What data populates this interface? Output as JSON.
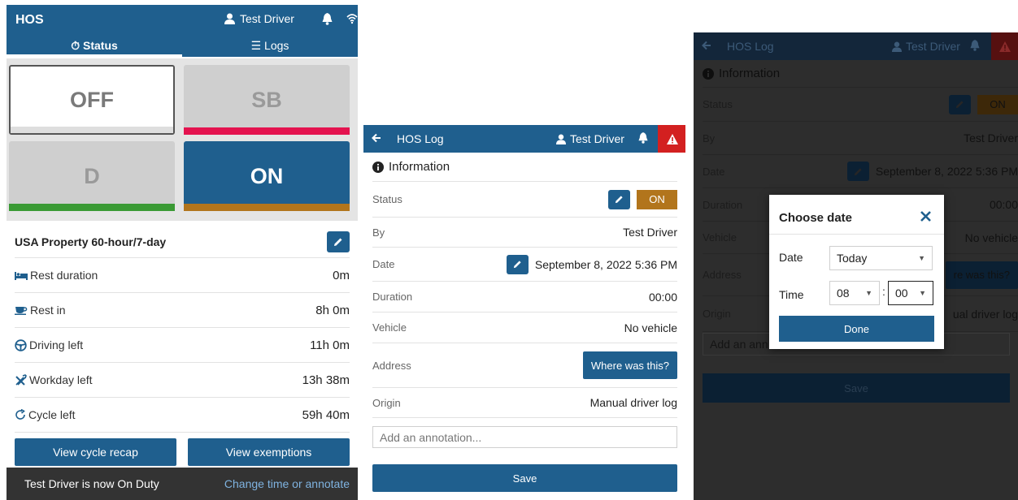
{
  "colors": {
    "primary": "#1f5f8e",
    "sb_bar": "#e4134f",
    "d_bar": "#3a9a34",
    "on_bar": "#b2751c",
    "alert": "#d32020",
    "toast_link": "#7fb3e0"
  },
  "panel1": {
    "app_name": "HOS",
    "user": "Test Driver",
    "tabs": [
      {
        "label": "Status",
        "icon": "timer-icon"
      },
      {
        "label": "Logs",
        "icon": "list-icon"
      }
    ],
    "statuses": {
      "off": "OFF",
      "sb": "SB",
      "d": "D",
      "on": "ON"
    },
    "ruleset": "USA Property 60-hour/7-day",
    "rows": [
      {
        "label": "Rest duration",
        "value": "0m",
        "icon": "bed-icon"
      },
      {
        "label": "Rest in",
        "value": "8h 0m",
        "icon": "coffee-icon"
      },
      {
        "label": "Driving left",
        "value": "11h 0m",
        "icon": "steering-wheel-icon"
      },
      {
        "label": "Workday left",
        "value": "13h 38m",
        "icon": "tools-icon"
      },
      {
        "label": "Cycle left",
        "value": "59h 40m",
        "icon": "cycle-icon"
      }
    ],
    "actions": {
      "recap": "View cycle recap",
      "exemptions": "View exemptions"
    },
    "toast": {
      "message": "Test Driver is now On Duty",
      "action": "Change time or annotate"
    }
  },
  "log": {
    "title": "HOS Log",
    "user": "Test Driver",
    "section": "Information",
    "status_label": "Status",
    "status_value": "ON",
    "by_label": "By",
    "by_value": "Test Driver",
    "date_label": "Date",
    "date_value": "September 8, 2022 5:36 PM",
    "duration_label": "Duration",
    "duration_value": "00:00",
    "vehicle_label": "Vehicle",
    "vehicle_value": "No vehicle",
    "address_label": "Address",
    "address_button": "Where was this?",
    "address_button_partial": "re was this?",
    "origin_label": "Origin",
    "origin_value": "Manual driver log",
    "origin_value_partial": "ual driver log",
    "annotation_placeholder": "Add an annotation...",
    "annotation_placeholder_partial": "Add an ann",
    "save": "Save"
  },
  "dialog": {
    "title": "Choose date",
    "date_label": "Date",
    "date_value": "Today",
    "time_label": "Time",
    "hour": "08",
    "minute": "00",
    "done": "Done"
  }
}
